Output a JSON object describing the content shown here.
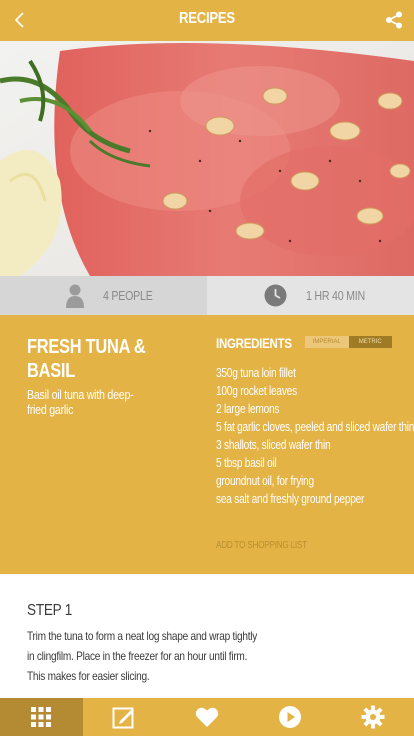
{
  "header": {
    "title": "RECIPES",
    "back_icon": "chevron-left-icon",
    "share_icon": "share-icon"
  },
  "hero": {
    "alt": "Fresh tuna carpaccio with rocket, lemon and fried garlic"
  },
  "info": {
    "people": "4 PEOPLE",
    "people_icon": "person-icon",
    "time": "1 HR 40 MIN",
    "time_icon": "clock-icon"
  },
  "recipe": {
    "title": "FRESH TUNA & BASIL",
    "subtitle": "Basil oil tuna with deep-fried garlic"
  },
  "ingredients": {
    "heading": "INGREDIENTS",
    "unit_imperial": "IMPERIAL",
    "unit_metric": "METRIC",
    "selected_unit": "METRIC",
    "items": [
      "350g tuna loin fillet",
      "100g rocket leaves",
      "2 large lemons",
      "5 fat garlic cloves, peeled and sliced wafer thin",
      "3 shallots, sliced wafer thin",
      "5 tbsp basil oil",
      "groundnut oil, for frying",
      "sea salt and freshly ground pepper"
    ],
    "add_to_list": "ADD TO SHOPPING LIST"
  },
  "step": {
    "title": "STEP 1",
    "text": "Trim the tuna to form a neat log shape and wrap tightly in clingfilm. Place in the freezer for an  hour until firm. This makes for easier slicing."
  },
  "bottom_nav": {
    "items": [
      "grid-icon",
      "edit-icon",
      "heart-icon",
      "play-icon",
      "gear-icon"
    ],
    "active": "grid-icon"
  },
  "colors": {
    "accent": "#e4b345",
    "accent_dark": "#b48a33",
    "grey_left": "#d6d6d6",
    "grey_right": "#e4e4e4"
  }
}
